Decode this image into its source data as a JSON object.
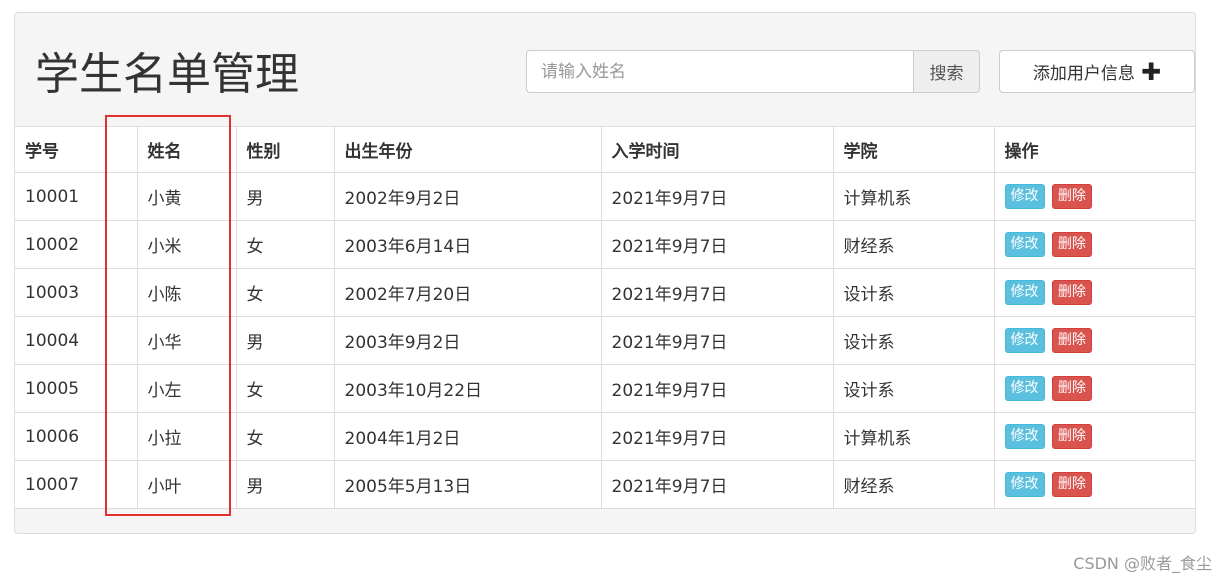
{
  "header": {
    "title": "学生名单管理",
    "search_placeholder": "请输入姓名",
    "search_value": "",
    "search_label": "搜索",
    "add_label": "添加用户信息"
  },
  "table": {
    "columns": [
      "学号",
      "",
      "姓名",
      "性别",
      "出生年份",
      "入学时间",
      "学院",
      "操作"
    ],
    "rows": [
      {
        "id": "10001",
        "name": "小黄",
        "gender": "男",
        "birth": "2002年9月2日",
        "enroll": "2021年9月7日",
        "college": "计算机系"
      },
      {
        "id": "10002",
        "name": "小米",
        "gender": "女",
        "birth": "2003年6月14日",
        "enroll": "2021年9月7日",
        "college": "财经系"
      },
      {
        "id": "10003",
        "name": "小陈",
        "gender": "女",
        "birth": "2002年7月20日",
        "enroll": "2021年9月7日",
        "college": "设计系"
      },
      {
        "id": "10004",
        "name": "小华",
        "gender": "男",
        "birth": "2003年9月2日",
        "enroll": "2021年9月7日",
        "college": "设计系"
      },
      {
        "id": "10005",
        "name": "小左",
        "gender": "女",
        "birth": "2003年10月22日",
        "enroll": "2021年9月7日",
        "college": "设计系"
      },
      {
        "id": "10006",
        "name": "小拉",
        "gender": "女",
        "birth": "2004年1月2日",
        "enroll": "2021年9月7日",
        "college": "计算机系"
      },
      {
        "id": "10007",
        "name": "小叶",
        "gender": "男",
        "birth": "2005年5月13日",
        "enroll": "2021年9月7日",
        "college": "财经系"
      }
    ],
    "edit_label": "修改",
    "delete_label": "删除"
  },
  "watermark": "CSDN @败者_食尘",
  "colors": {
    "info": "#5bc0de",
    "danger": "#d9534f",
    "highlight": "#e03030",
    "panel": "#f5f5f5"
  },
  "icons": {
    "add": "plus-icon"
  }
}
